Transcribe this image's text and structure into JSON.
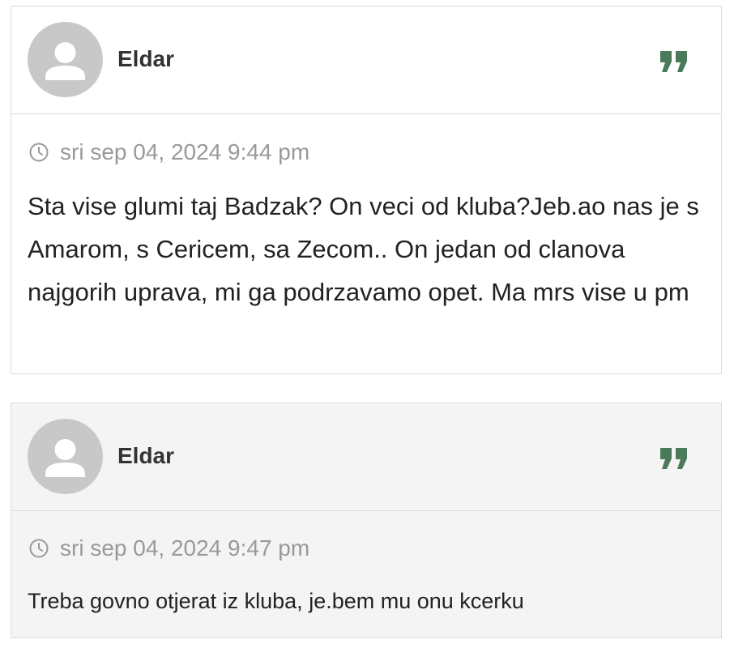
{
  "posts": [
    {
      "author": "Eldar",
      "timestamp": "sri sep 04, 2024 9:44 pm",
      "content": "Sta vise glumi taj Badzak? On veci od kluba?Jeb.ao nas je s Amarom, s Cericem, sa Zecom.. On jedan od clanova najgorih uprava, mi ga podrzavamo opet. Ma mrs vise u pm",
      "avatar_icon": "user-silhouette-icon",
      "quote_icon": "quote-icon"
    },
    {
      "author": "Eldar",
      "timestamp": "sri sep 04, 2024 9:47 pm",
      "content": "Treba govno otjerat iz kluba, je.bem mu onu kcerku",
      "avatar_icon": "user-silhouette-icon",
      "quote_icon": "quote-icon"
    }
  ],
  "colors": {
    "quote_accent": "#4a7a5a",
    "avatar_bg": "#c8c8c8",
    "meta_text": "#999999",
    "post_alt_bg": "#f4f4f4"
  }
}
